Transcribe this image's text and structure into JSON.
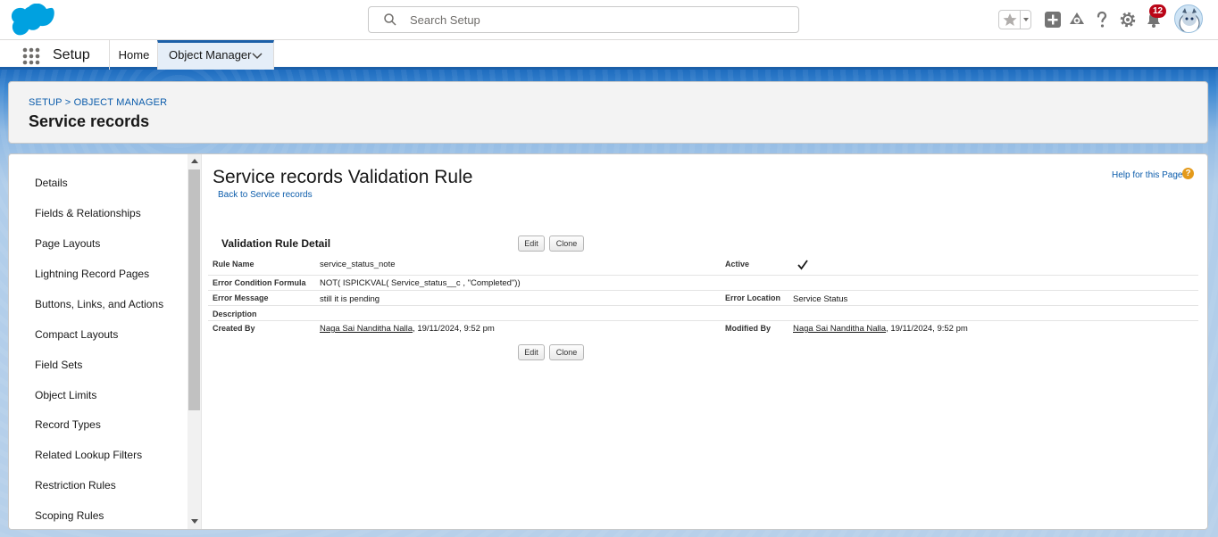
{
  "header": {
    "search_placeholder": "Search Setup",
    "notification_count": "12",
    "icons": [
      "salesforce-cloud-logo",
      "star-icon",
      "add-icon",
      "trailhead-icon",
      "help-icon",
      "gear-icon",
      "bell-icon",
      "avatar"
    ]
  },
  "context_bar": {
    "app_name": "Setup",
    "tabs": [
      {
        "label": "Home"
      },
      {
        "label": "Object Manager",
        "active": true
      }
    ]
  },
  "page_header": {
    "breadcrumb": "SETUP > OBJECT MANAGER",
    "title": "Service records"
  },
  "sidebar": {
    "items": [
      {
        "label": "Details"
      },
      {
        "label": "Fields & Relationships"
      },
      {
        "label": "Page Layouts"
      },
      {
        "label": "Lightning Record Pages"
      },
      {
        "label": "Buttons, Links, and Actions"
      },
      {
        "label": "Compact Layouts"
      },
      {
        "label": "Field Sets"
      },
      {
        "label": "Object Limits"
      },
      {
        "label": "Record Types"
      },
      {
        "label": "Related Lookup Filters"
      },
      {
        "label": "Restriction Rules"
      },
      {
        "label": "Scoping Rules"
      }
    ]
  },
  "main": {
    "title": "Service records Validation Rule",
    "back_link": "Back to Service records",
    "help_link": "Help for this Page",
    "section_title": "Validation Rule Detail",
    "edit_label": "Edit",
    "clone_label": "Clone",
    "fields": {
      "rule_name_label": "Rule Name",
      "rule_name_value": "service_status_note",
      "active_label": "Active",
      "active_value": true,
      "formula_label": "Error Condition Formula",
      "formula_value": "NOT( ISPICKVAL( Service_status__c , \"Completed\"))",
      "error_message_label": "Error Message",
      "error_message_value": "still it is pending",
      "error_location_label": "Error Location",
      "error_location_value": "Service Status",
      "description_label": "Description",
      "description_value": "",
      "created_by_label": "Created By",
      "created_by_user": "Naga Sai Nanditha Nalla",
      "created_by_date": ", 19/11/2024, 9:52 pm",
      "modified_by_label": "Modified By",
      "modified_by_user": "Naga Sai Nanditha Nalla",
      "modified_by_date": ", 19/11/2024, 9:52 pm"
    }
  },
  "colors": {
    "brand_blue": "#1b5fa8",
    "link_blue": "#0b5cab",
    "badge_red": "#ba0517",
    "help_orange": "#e49a1b"
  }
}
